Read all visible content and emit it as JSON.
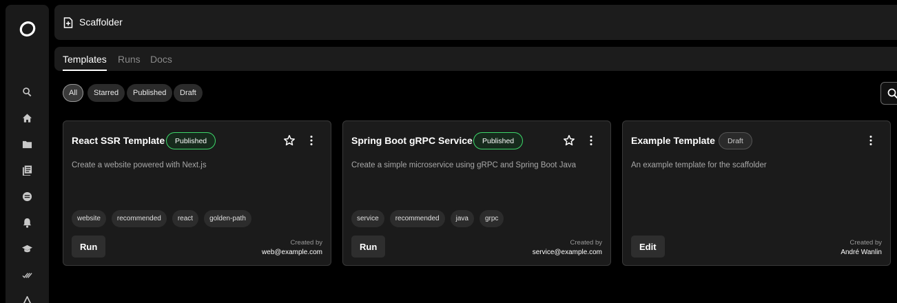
{
  "header": {
    "title": "Scaffolder",
    "icon": "new-file-icon"
  },
  "tabs": [
    {
      "label": "Templates",
      "active": true
    },
    {
      "label": "Runs",
      "active": false
    },
    {
      "label": "Docs",
      "active": false
    }
  ],
  "filters": [
    {
      "label": "All",
      "active": true
    },
    {
      "label": "Starred",
      "active": false
    },
    {
      "label": "Published",
      "active": false
    },
    {
      "label": "Draft",
      "active": false
    }
  ],
  "sidebar": {
    "items": [
      {
        "icon": "search-icon"
      },
      {
        "icon": "home-icon"
      },
      {
        "icon": "folder-icon"
      },
      {
        "icon": "library-icon"
      },
      {
        "icon": "chat-icon"
      },
      {
        "icon": "bell-icon"
      },
      {
        "icon": "graduation-cap-icon"
      },
      {
        "icon": "double-check-icon"
      },
      {
        "icon": "triangle-icon"
      }
    ]
  },
  "cards": [
    {
      "title": "React SSR Template",
      "status": "Published",
      "description": "Create a website powered with Next.js",
      "tags": [
        "website",
        "recommended",
        "react",
        "golden-path"
      ],
      "action": "Run",
      "created_label": "Created by",
      "created_by": "web@example.com"
    },
    {
      "title": "Spring Boot gRPC Service",
      "status": "Published",
      "description": "Create a simple microservice using gRPC and Spring Boot Java",
      "tags": [
        "service",
        "recommended",
        "java",
        "grpc"
      ],
      "action": "Run",
      "created_label": "Created by",
      "created_by": "service@example.com"
    },
    {
      "title": "Example Template",
      "status": "Draft",
      "description": "An example template for the scaffolder",
      "tags": [],
      "action": "Edit",
      "created_label": "Created by",
      "created_by": "André Wanlin"
    }
  ],
  "colors": {
    "published_border": "#3ed96b",
    "background": "#000000",
    "panel": "#1c1c1c"
  }
}
